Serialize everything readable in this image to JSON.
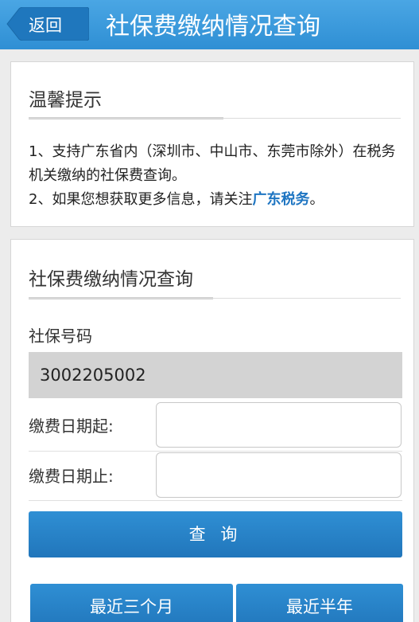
{
  "header": {
    "back_label": "返回",
    "title": "社保费缴纳情况查询",
    "color": "#3a9bdc"
  },
  "tips": {
    "title": "温馨提示",
    "line1": "1、支持广东省内（深圳市、中山市、东莞市除外）在税务机关缴纳的社保费查询。",
    "line2_prefix": "2、如果您想获取更多信息，请关注",
    "line2_link": "广东税务",
    "line2_suffix": "。"
  },
  "query": {
    "title": "社保费缴纳情况查询",
    "ss_number_label": "社保号码",
    "ss_number_value": "3002205002",
    "start_date_label": "缴费日期起:",
    "start_date_value": "",
    "end_date_label": "缴费日期止:",
    "end_date_value": "",
    "query_button": "查 询",
    "quick_buttons": [
      "最近三个月",
      "最近半年"
    ]
  },
  "colors": {
    "accent": "#2f8fd4",
    "link": "#1e75c2",
    "background": "#ececec"
  }
}
